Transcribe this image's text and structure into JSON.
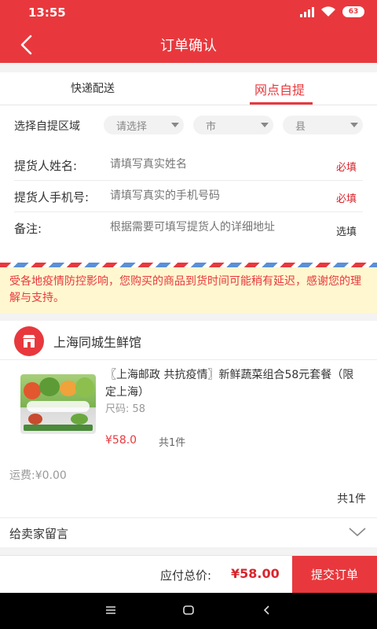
{
  "status_bar": {
    "time": "13:55",
    "battery": "63"
  },
  "nav": {
    "title": "订单确认"
  },
  "tabs": [
    {
      "label": "快递配送",
      "active": false
    },
    {
      "label": "网点自提",
      "active": true
    }
  ],
  "form": {
    "region_label": "选择自提区域",
    "selects": [
      {
        "value": "请选择"
      },
      {
        "value": "市"
      },
      {
        "value": "县"
      }
    ],
    "rows": [
      {
        "label": "提货人姓名:",
        "placeholder": "请填写真实姓名",
        "flag": "必填"
      },
      {
        "label": "提货人手机号:",
        "placeholder": "请填写真实的手机号码",
        "flag": "必填"
      },
      {
        "label": "备注:",
        "placeholder": "根据需要可填写提货人的详细地址",
        "flag": "选填"
      }
    ]
  },
  "notice": "受各地疫情防控影响，您购买的商品到货时间可能稍有延迟，感谢您的理解与支持。",
  "shop": {
    "name": "上海同城生鲜馆"
  },
  "product": {
    "title": "〖上海邮政 共抗疫情〗新鲜蔬菜组合58元套餐（限定上海）",
    "size": "尺码: 58",
    "price": "¥58.0",
    "qty": "共1件",
    "freight": "运费:¥0.00",
    "total_count": "共1件"
  },
  "message": {
    "label": "给卖家留言"
  },
  "bottom": {
    "sum_label": "应付总价:",
    "sum_value": "¥58.00",
    "submit": "提交订单"
  },
  "colors": {
    "accent": "#e8383d",
    "notice_bg": "#fff7cf",
    "price": "#d9252d"
  }
}
